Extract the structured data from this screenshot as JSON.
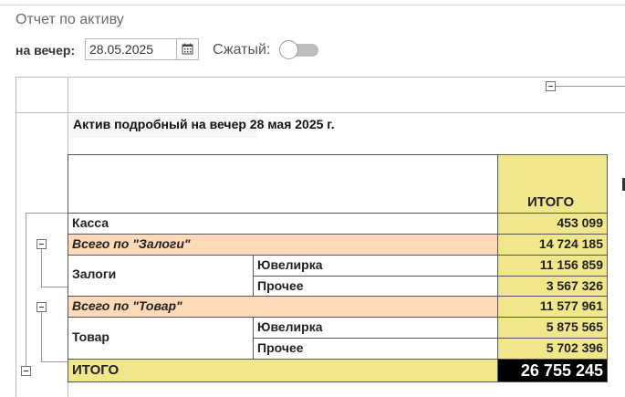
{
  "header": {
    "title": "Отчет по активу",
    "date_label": "на вечер:",
    "date_value": "28.05.2025",
    "compact_label": "Сжатый:",
    "compact_on": false
  },
  "report": {
    "title": "Актив подробный на вечер 28 мая 2025 г.",
    "total_header": "ИТОГО",
    "rows": {
      "kassa": {
        "label": "Касса",
        "value": "453 099"
      },
      "zalogi_total": {
        "label": "Всего по \"Залоги\"",
        "value": "14 724 185"
      },
      "zalogi": {
        "label": "Залоги",
        "sub": [
          {
            "label": "Ювелирка",
            "value": "11 156 859"
          },
          {
            "label": "Прочее",
            "value": "3 567 326"
          }
        ]
      },
      "tovar_total": {
        "label": "Всего по \"Товар\"",
        "value": "11 577 961"
      },
      "tovar": {
        "label": "Товар",
        "sub": [
          {
            "label": "Ювелирка",
            "value": "5 875 565"
          },
          {
            "label": "Прочее",
            "value": "5 702 396"
          }
        ]
      },
      "grand_total": {
        "label": "ИТОГО",
        "value": "26 755 245"
      }
    },
    "colors": {
      "total_column": "#f0e68c",
      "group_total_row": "#ffdab9",
      "grand_total_value_bg": "#000000"
    }
  }
}
